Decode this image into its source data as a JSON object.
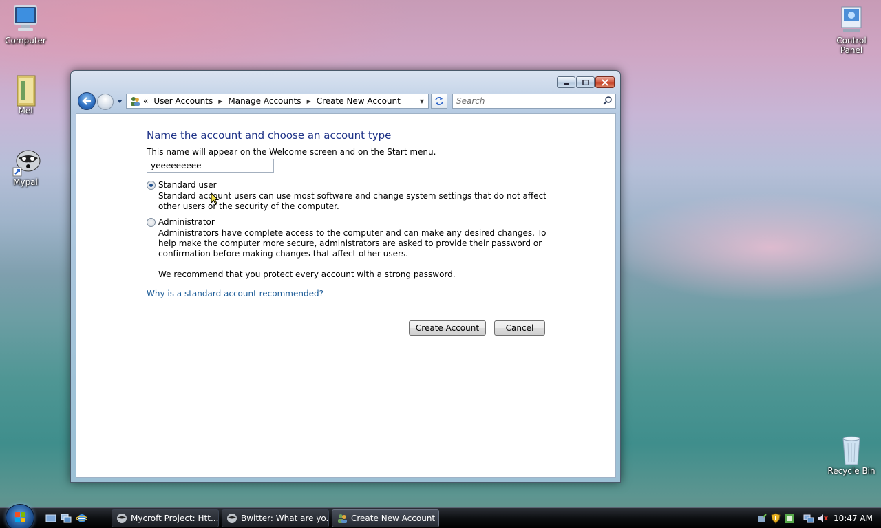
{
  "desktop": {
    "icons": [
      {
        "label": "Computer"
      },
      {
        "label": "Mel"
      },
      {
        "label": "Mypal"
      },
      {
        "label": "Control Panel"
      },
      {
        "label": "Recycle Bin"
      }
    ]
  },
  "window": {
    "breadcrumb": [
      "User Accounts",
      "Manage Accounts",
      "Create New Account"
    ],
    "overflow_glyph": "«",
    "search_placeholder": "Search",
    "heading": "Name the account and choose an account type",
    "subheading": "This name will appear on the Welcome screen and on the Start menu.",
    "name_value": "yeeeeeeeee",
    "options": [
      {
        "label": "Standard user",
        "checked": true,
        "description": "Standard account users can use most software and change system settings that do not affect other users or the security of the computer."
      },
      {
        "label": "Administrator",
        "checked": false,
        "description": "Administrators have complete access to the computer and can make any desired changes. To help make the computer more secure, administrators are asked to provide their password or confirmation before making changes that affect other users."
      }
    ],
    "recommend_text": "We recommend that you protect every account with a strong password.",
    "help_link": "Why is a standard account recommended?",
    "create_button": "Create Account",
    "cancel_button": "Cancel"
  },
  "taskbar": {
    "tasks": [
      {
        "label": "Mycroft Project: Htt...",
        "active": false
      },
      {
        "label": "Bwitter: What are yo...",
        "active": false
      },
      {
        "label": "Create New Account",
        "active": true
      }
    ],
    "clock": "10:47 AM"
  },
  "colors": {
    "heading": "#1e3287",
    "link": "#1a5a96"
  }
}
